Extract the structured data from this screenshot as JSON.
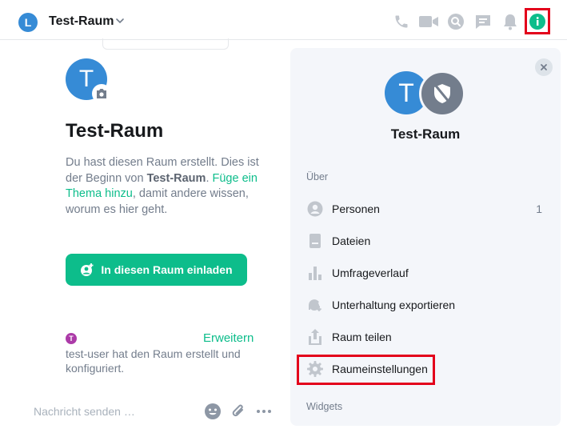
{
  "header": {
    "avatar_letter": "L",
    "room_name": "Test-Raum"
  },
  "timeline": {
    "avatar_letter": "T",
    "room_heading": "Test-Raum",
    "intro_prefix": "Du hast diesen Raum erstellt. Dies ist der Beginn von ",
    "intro_room": "Test-Raum",
    "intro_dot": ".",
    "topic_link": "Füge ein Thema hinzu",
    "intro_suffix": ", damit andere wissen, worum es hier geht.",
    "invite_button": "In diesen Raum einladen",
    "event_avatar_letter": "T",
    "expand_link": "Erweitern",
    "event_text": "test-user hat den Raum erstellt und konfiguriert."
  },
  "composer": {
    "placeholder": "Nachricht senden …"
  },
  "right_panel": {
    "avatar_letter": "T",
    "room_name": "Test-Raum",
    "section_about": "Über",
    "items": [
      {
        "label": "Personen",
        "icon": "people-icon",
        "count": "1"
      },
      {
        "label": "Dateien",
        "icon": "files-icon"
      },
      {
        "label": "Umfrageverlauf",
        "icon": "poll-history-icon"
      },
      {
        "label": "Unterhaltung exportieren",
        "icon": "export-chat-icon"
      },
      {
        "label": "Raum teilen",
        "icon": "share-icon"
      },
      {
        "label": "Raumeinstellungen",
        "icon": "settings-icon"
      }
    ],
    "section_widgets": "Widgets"
  },
  "colors": {
    "accent": "#0dbd8b",
    "avatar_blue": "#368bd6",
    "highlight_red": "#e3001b",
    "muted_text": "#737d8c",
    "panel_bg": "#f4f6fa"
  }
}
